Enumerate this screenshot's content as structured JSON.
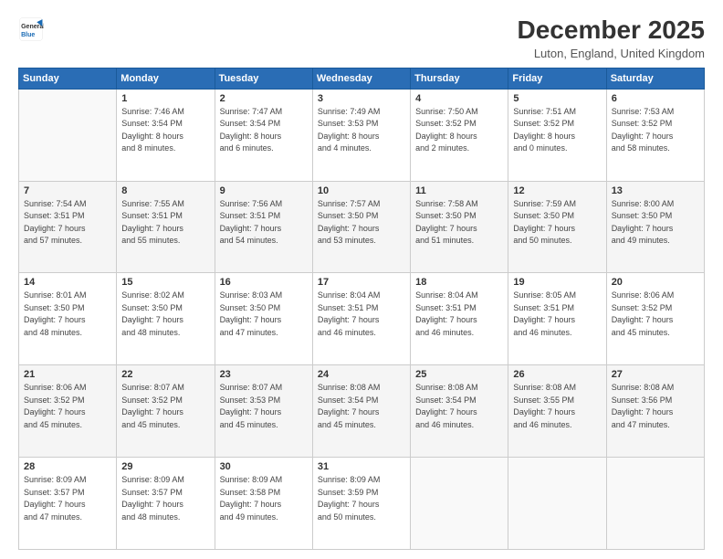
{
  "logo": {
    "line1": "General",
    "line2": "Blue"
  },
  "header": {
    "title": "December 2025",
    "location": "Luton, England, United Kingdom"
  },
  "weekdays": [
    "Sunday",
    "Monday",
    "Tuesday",
    "Wednesday",
    "Thursday",
    "Friday",
    "Saturday"
  ],
  "weeks": [
    [
      {
        "day": "",
        "info": ""
      },
      {
        "day": "1",
        "info": "Sunrise: 7:46 AM\nSunset: 3:54 PM\nDaylight: 8 hours\nand 8 minutes."
      },
      {
        "day": "2",
        "info": "Sunrise: 7:47 AM\nSunset: 3:54 PM\nDaylight: 8 hours\nand 6 minutes."
      },
      {
        "day": "3",
        "info": "Sunrise: 7:49 AM\nSunset: 3:53 PM\nDaylight: 8 hours\nand 4 minutes."
      },
      {
        "day": "4",
        "info": "Sunrise: 7:50 AM\nSunset: 3:52 PM\nDaylight: 8 hours\nand 2 minutes."
      },
      {
        "day": "5",
        "info": "Sunrise: 7:51 AM\nSunset: 3:52 PM\nDaylight: 8 hours\nand 0 minutes."
      },
      {
        "day": "6",
        "info": "Sunrise: 7:53 AM\nSunset: 3:52 PM\nDaylight: 7 hours\nand 58 minutes."
      }
    ],
    [
      {
        "day": "7",
        "info": "Sunrise: 7:54 AM\nSunset: 3:51 PM\nDaylight: 7 hours\nand 57 minutes."
      },
      {
        "day": "8",
        "info": "Sunrise: 7:55 AM\nSunset: 3:51 PM\nDaylight: 7 hours\nand 55 minutes."
      },
      {
        "day": "9",
        "info": "Sunrise: 7:56 AM\nSunset: 3:51 PM\nDaylight: 7 hours\nand 54 minutes."
      },
      {
        "day": "10",
        "info": "Sunrise: 7:57 AM\nSunset: 3:50 PM\nDaylight: 7 hours\nand 53 minutes."
      },
      {
        "day": "11",
        "info": "Sunrise: 7:58 AM\nSunset: 3:50 PM\nDaylight: 7 hours\nand 51 minutes."
      },
      {
        "day": "12",
        "info": "Sunrise: 7:59 AM\nSunset: 3:50 PM\nDaylight: 7 hours\nand 50 minutes."
      },
      {
        "day": "13",
        "info": "Sunrise: 8:00 AM\nSunset: 3:50 PM\nDaylight: 7 hours\nand 49 minutes."
      }
    ],
    [
      {
        "day": "14",
        "info": "Sunrise: 8:01 AM\nSunset: 3:50 PM\nDaylight: 7 hours\nand 48 minutes."
      },
      {
        "day": "15",
        "info": "Sunrise: 8:02 AM\nSunset: 3:50 PM\nDaylight: 7 hours\nand 48 minutes."
      },
      {
        "day": "16",
        "info": "Sunrise: 8:03 AM\nSunset: 3:50 PM\nDaylight: 7 hours\nand 47 minutes."
      },
      {
        "day": "17",
        "info": "Sunrise: 8:04 AM\nSunset: 3:51 PM\nDaylight: 7 hours\nand 46 minutes."
      },
      {
        "day": "18",
        "info": "Sunrise: 8:04 AM\nSunset: 3:51 PM\nDaylight: 7 hours\nand 46 minutes."
      },
      {
        "day": "19",
        "info": "Sunrise: 8:05 AM\nSunset: 3:51 PM\nDaylight: 7 hours\nand 46 minutes."
      },
      {
        "day": "20",
        "info": "Sunrise: 8:06 AM\nSunset: 3:52 PM\nDaylight: 7 hours\nand 45 minutes."
      }
    ],
    [
      {
        "day": "21",
        "info": "Sunrise: 8:06 AM\nSunset: 3:52 PM\nDaylight: 7 hours\nand 45 minutes."
      },
      {
        "day": "22",
        "info": "Sunrise: 8:07 AM\nSunset: 3:52 PM\nDaylight: 7 hours\nand 45 minutes."
      },
      {
        "day": "23",
        "info": "Sunrise: 8:07 AM\nSunset: 3:53 PM\nDaylight: 7 hours\nand 45 minutes."
      },
      {
        "day": "24",
        "info": "Sunrise: 8:08 AM\nSunset: 3:54 PM\nDaylight: 7 hours\nand 45 minutes."
      },
      {
        "day": "25",
        "info": "Sunrise: 8:08 AM\nSunset: 3:54 PM\nDaylight: 7 hours\nand 46 minutes."
      },
      {
        "day": "26",
        "info": "Sunrise: 8:08 AM\nSunset: 3:55 PM\nDaylight: 7 hours\nand 46 minutes."
      },
      {
        "day": "27",
        "info": "Sunrise: 8:08 AM\nSunset: 3:56 PM\nDaylight: 7 hours\nand 47 minutes."
      }
    ],
    [
      {
        "day": "28",
        "info": "Sunrise: 8:09 AM\nSunset: 3:57 PM\nDaylight: 7 hours\nand 47 minutes."
      },
      {
        "day": "29",
        "info": "Sunrise: 8:09 AM\nSunset: 3:57 PM\nDaylight: 7 hours\nand 48 minutes."
      },
      {
        "day": "30",
        "info": "Sunrise: 8:09 AM\nSunset: 3:58 PM\nDaylight: 7 hours\nand 49 minutes."
      },
      {
        "day": "31",
        "info": "Sunrise: 8:09 AM\nSunset: 3:59 PM\nDaylight: 7 hours\nand 50 minutes."
      },
      {
        "day": "",
        "info": ""
      },
      {
        "day": "",
        "info": ""
      },
      {
        "day": "",
        "info": ""
      }
    ]
  ]
}
